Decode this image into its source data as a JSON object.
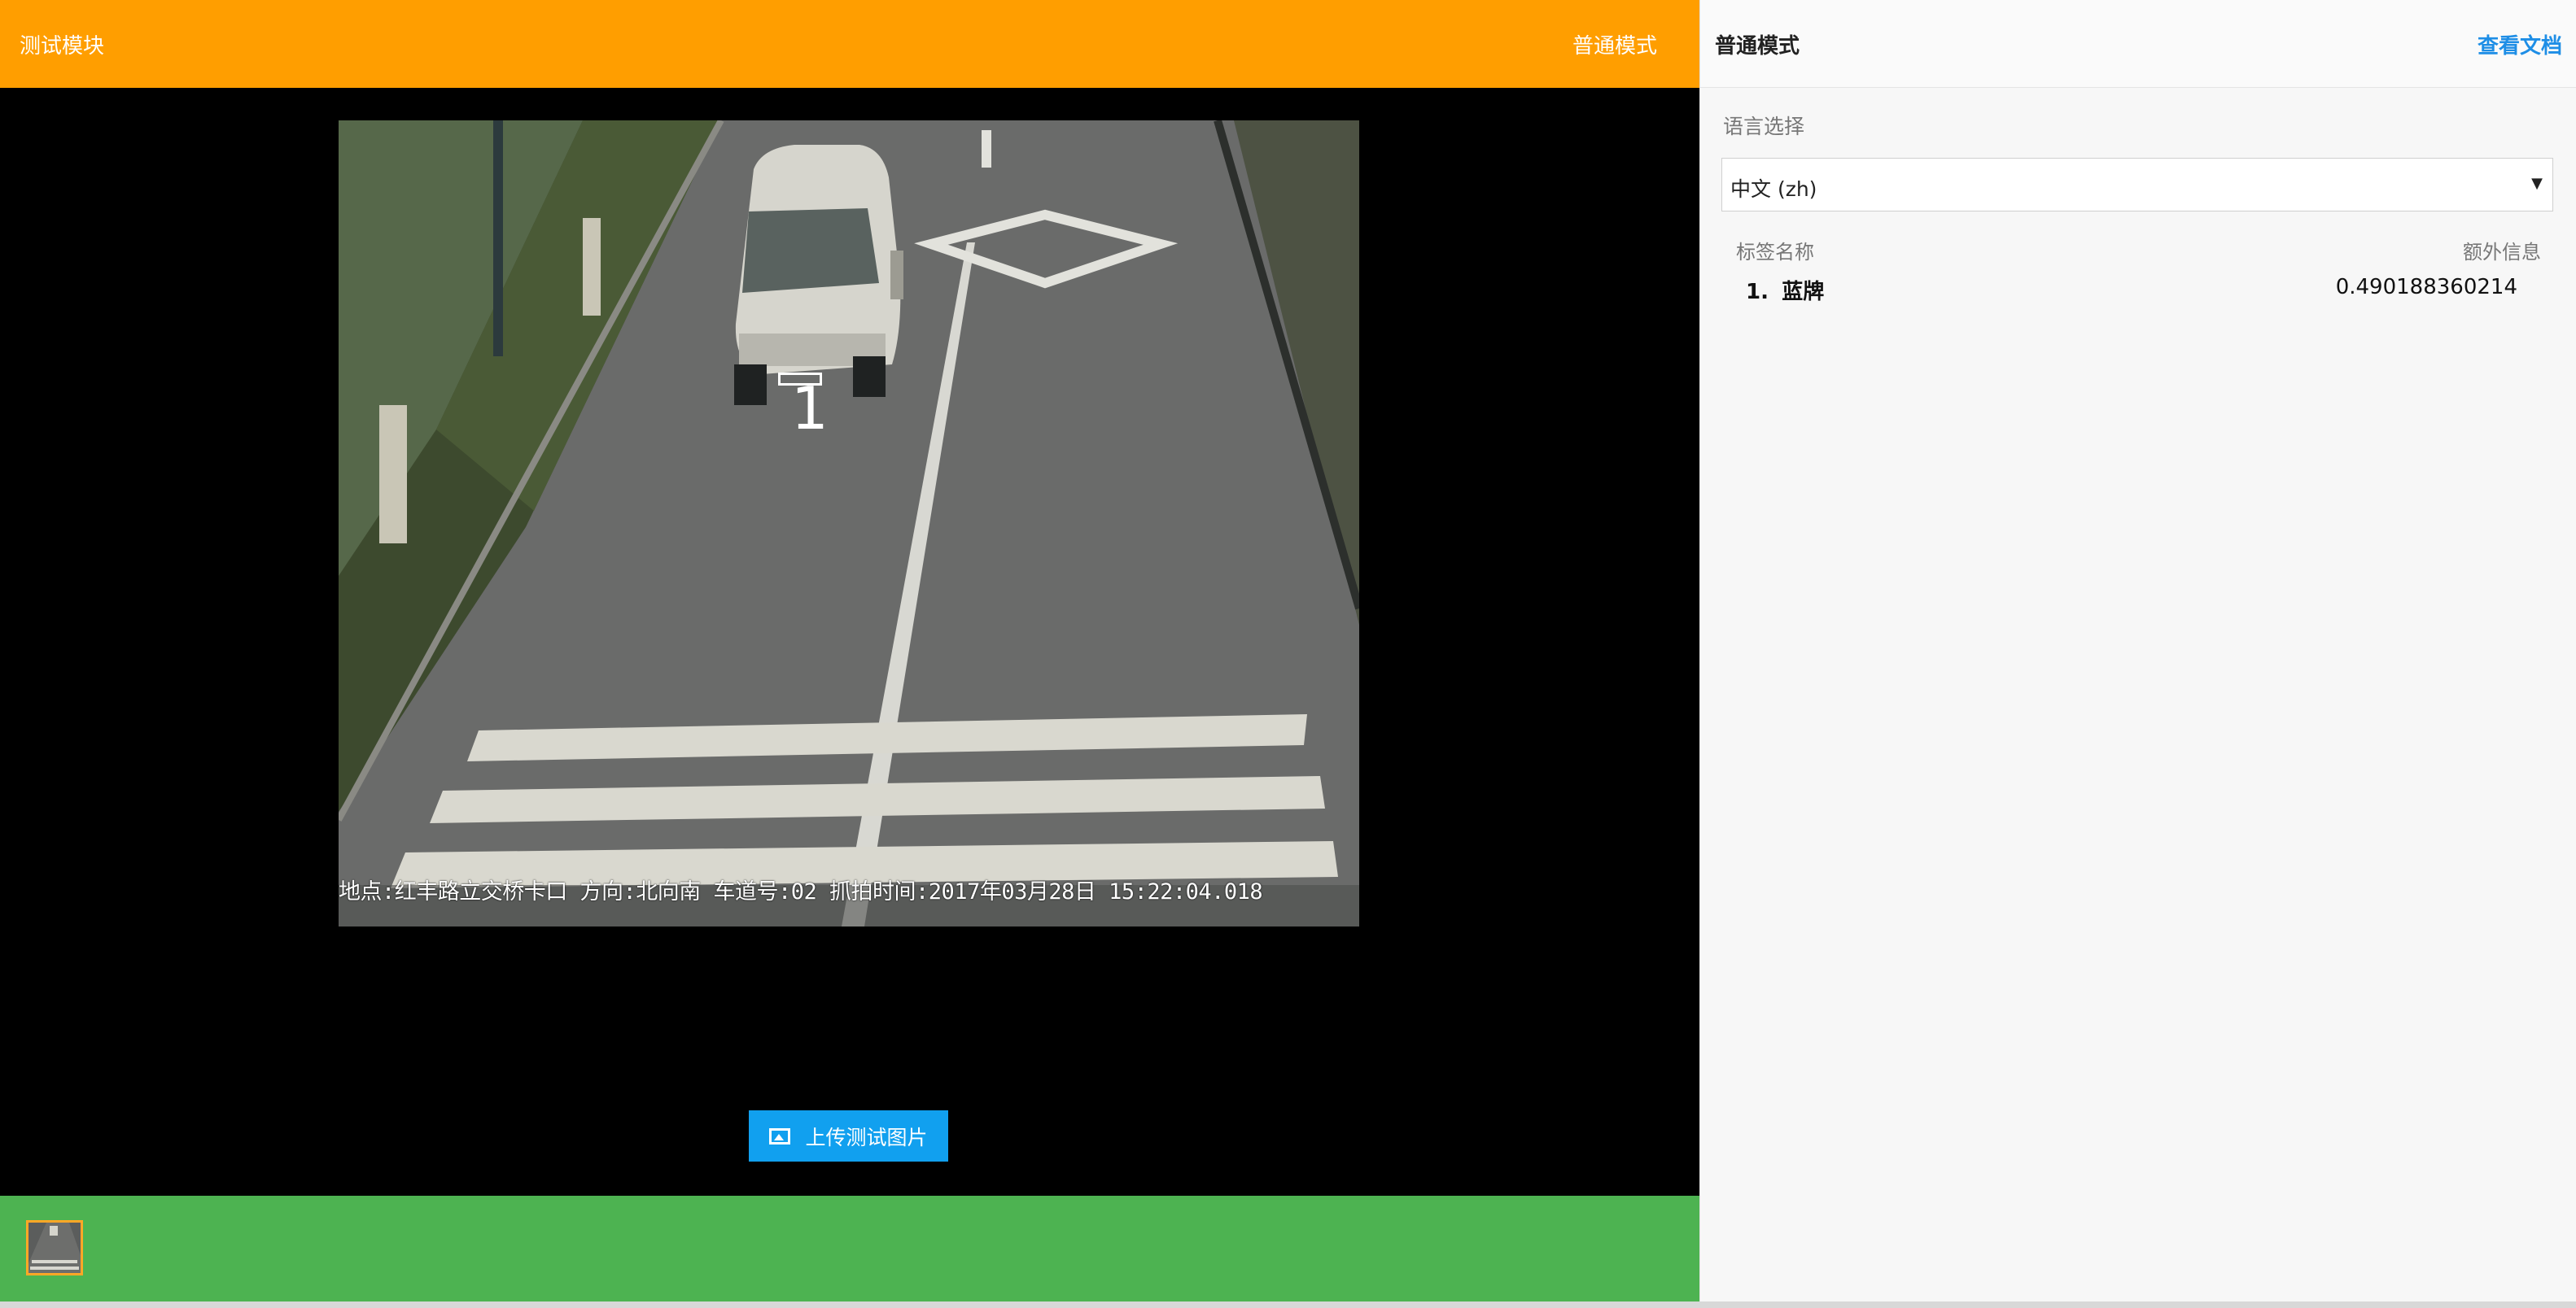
{
  "header": {
    "title": "测试模块",
    "mode": "普通模式"
  },
  "image": {
    "overlay_text": "地点:红丰路立交桥卡口 方向:北向南 车道号:02 抓拍时间:2017年03月28日 15:22:04.018",
    "detection_label": "1"
  },
  "upload": {
    "label": "上传测试图片",
    "icon": "image-icon"
  },
  "panel": {
    "mode_title": "普通模式",
    "docs_link": "查看文档",
    "language_label": "语言选择",
    "language_value": "中文 (zh)",
    "col_label_name": "标签名称",
    "col_extra_info": "额外信息",
    "results": [
      {
        "index": "1.",
        "name": "蓝牌",
        "score": "0.490188360214"
      }
    ]
  },
  "colors": {
    "topbar": "#ff9e00",
    "upload_button": "#11a0ef",
    "thumb_bar": "#4db351",
    "link": "#1e8ee6"
  }
}
